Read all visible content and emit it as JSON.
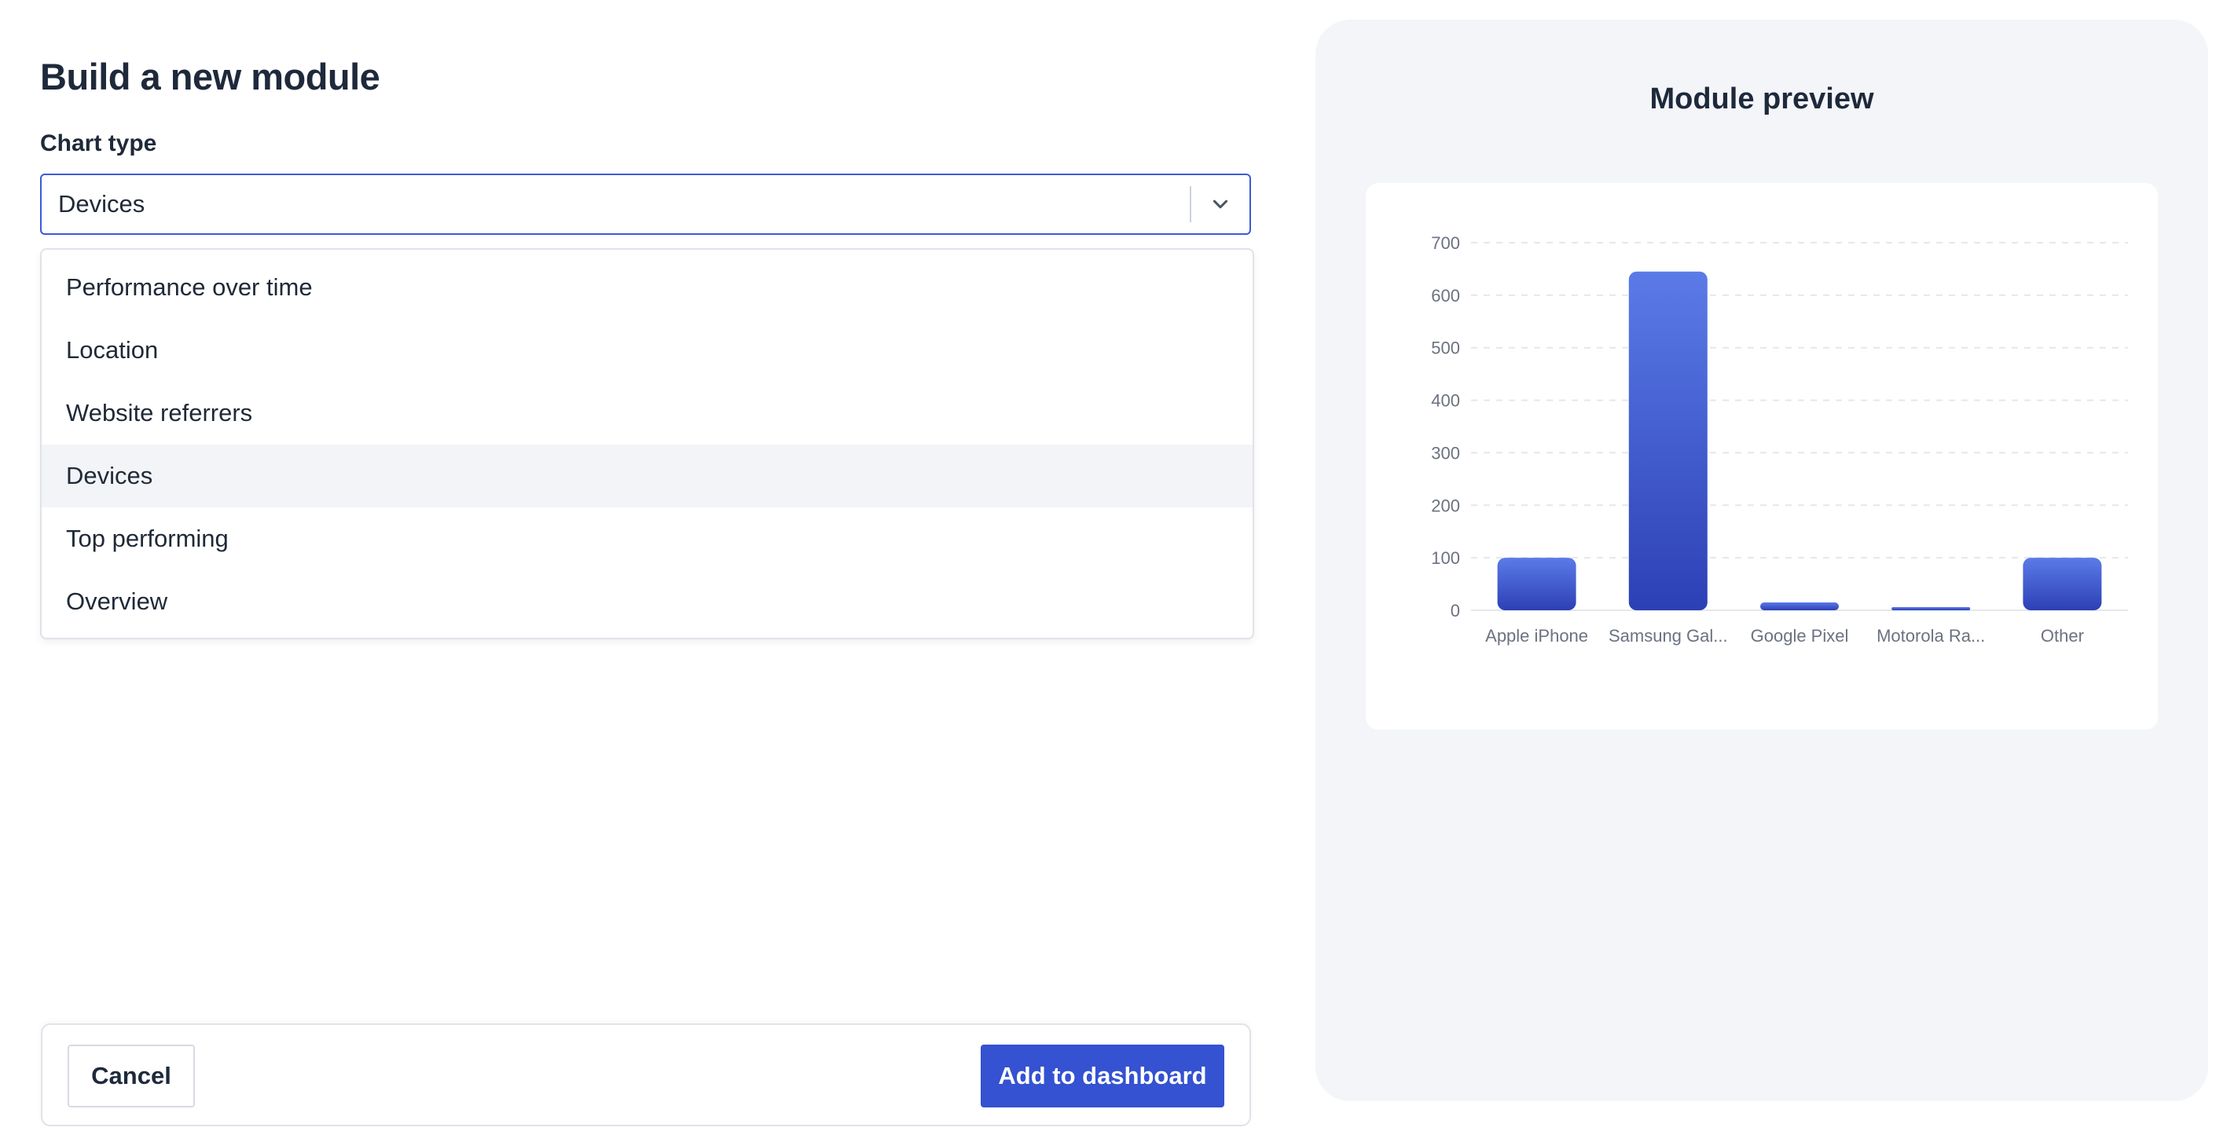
{
  "page": {
    "title": "Build a new module"
  },
  "form": {
    "chart_type_label": "Chart type",
    "selected_value": "Devices",
    "options": [
      {
        "label": "Performance over time",
        "active": false
      },
      {
        "label": "Location",
        "active": false
      },
      {
        "label": "Website referrers",
        "active": false
      },
      {
        "label": "Devices",
        "active": true
      },
      {
        "label": "Top performing",
        "active": false
      },
      {
        "label": "Overview",
        "active": false
      }
    ]
  },
  "footer": {
    "cancel_label": "Cancel",
    "add_label": "Add to dashboard"
  },
  "preview": {
    "title": "Module preview"
  },
  "colors": {
    "accent": "#3452d1",
    "bar_top": "#5b7be8",
    "bar_bottom": "#2c40b5",
    "select_border": "#3a5bd9"
  },
  "icons": {
    "select_toggle": "chevron-down-icon"
  },
  "chart_data": {
    "type": "bar",
    "categories": [
      "Apple iPhone",
      "Samsung Gal...",
      "Google Pixel",
      "Motorola Ra...",
      "Other"
    ],
    "values": [
      100,
      645,
      15,
      5,
      100
    ],
    "ylim": [
      0,
      700
    ],
    "yticks": [
      0,
      100,
      200,
      300,
      400,
      500,
      600,
      700
    ],
    "grid": true,
    "title": "",
    "xlabel": "",
    "ylabel": ""
  }
}
